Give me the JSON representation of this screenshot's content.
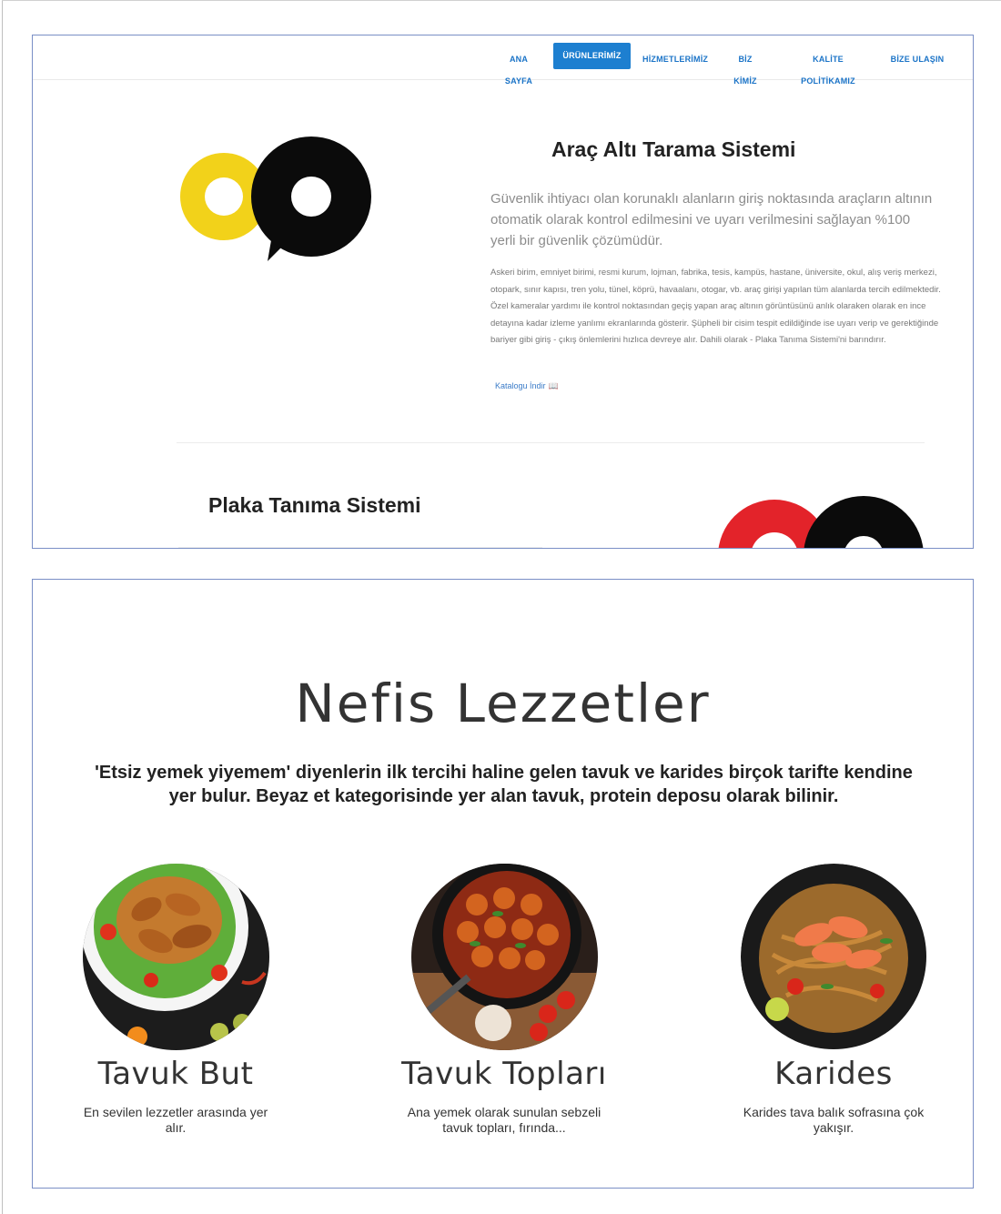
{
  "nav": {
    "items": [
      "ANA SAYFA",
      "ÜRÜNLERİMİZ",
      "HİZMETLERİMİZ",
      "BİZ KİMİZ",
      "KALİTE POLİTİKAMIZ",
      "BİZE ULAŞIN"
    ],
    "active_index": 1
  },
  "product1": {
    "title": "Araç Altı Tarama Sistemi",
    "lead": "Güvenlik ihtiyacı olan korunaklı alanların giriş noktasında araçların altının otomatik olarak kontrol edilmesini ve uyarı verilmesini sağlayan %100 yerli bir güvenlik çözümüdür.",
    "body": "Askeri birim, emniyet birimi, resmi kurum, lojman, fabrika, tesis, kampüs, hastane, üniversite, okul, alış veriş merkezi, otopark, sınır kapısı, tren yolu, tünel, köprü, havaalanı, otogar, vb. araç girişi yapılan tüm alanlarda tercih edilmektedir. Özel kameralar yardımı ile kontrol noktasından geçiş yapan araç altının görüntüsünü anlık olaraken olarak en ince detayına kadar izleme yanlımı ekranlarında gösterir. Şüpheli bir cisim tespit edildiğinde ise uyarı verip ve gerektiğinde bariyer gibi giriş - çıkış önlemlerini hızlıca devreye alır. Dahili olarak       - Plaka Tanıma Sistemi'ni barındırır.",
    "catalog_link": "Katalogu İndir",
    "logo_colors": {
      "left": "#f2d21a",
      "right": "#0b0b0b"
    }
  },
  "product2": {
    "title": "Plaka Tanıma Sistemi",
    "logo_colors": {
      "left": "#e3232a",
      "right": "#0b0b0b"
    }
  },
  "food": {
    "headline": "Nefis Lezzetler",
    "intro": "'Etsiz yemek yiyemem' diyenlerin ilk tercihi haline gelen tavuk ve karides birçok tarifte kendine yer bulur. Beyaz et kategorisinde yer alan tavuk, protein deposu olarak bilinir.",
    "cards": [
      {
        "title": "Tavuk But",
        "desc": "En sevilen lezzetler arasında yer alır."
      },
      {
        "title": "Tavuk Topları",
        "desc": "Ana yemek olarak sunulan sebzeli tavuk topları, fırında..."
      },
      {
        "title": "Karides",
        "desc": "Karides tava balık sofrasına çok yakışır."
      }
    ]
  }
}
